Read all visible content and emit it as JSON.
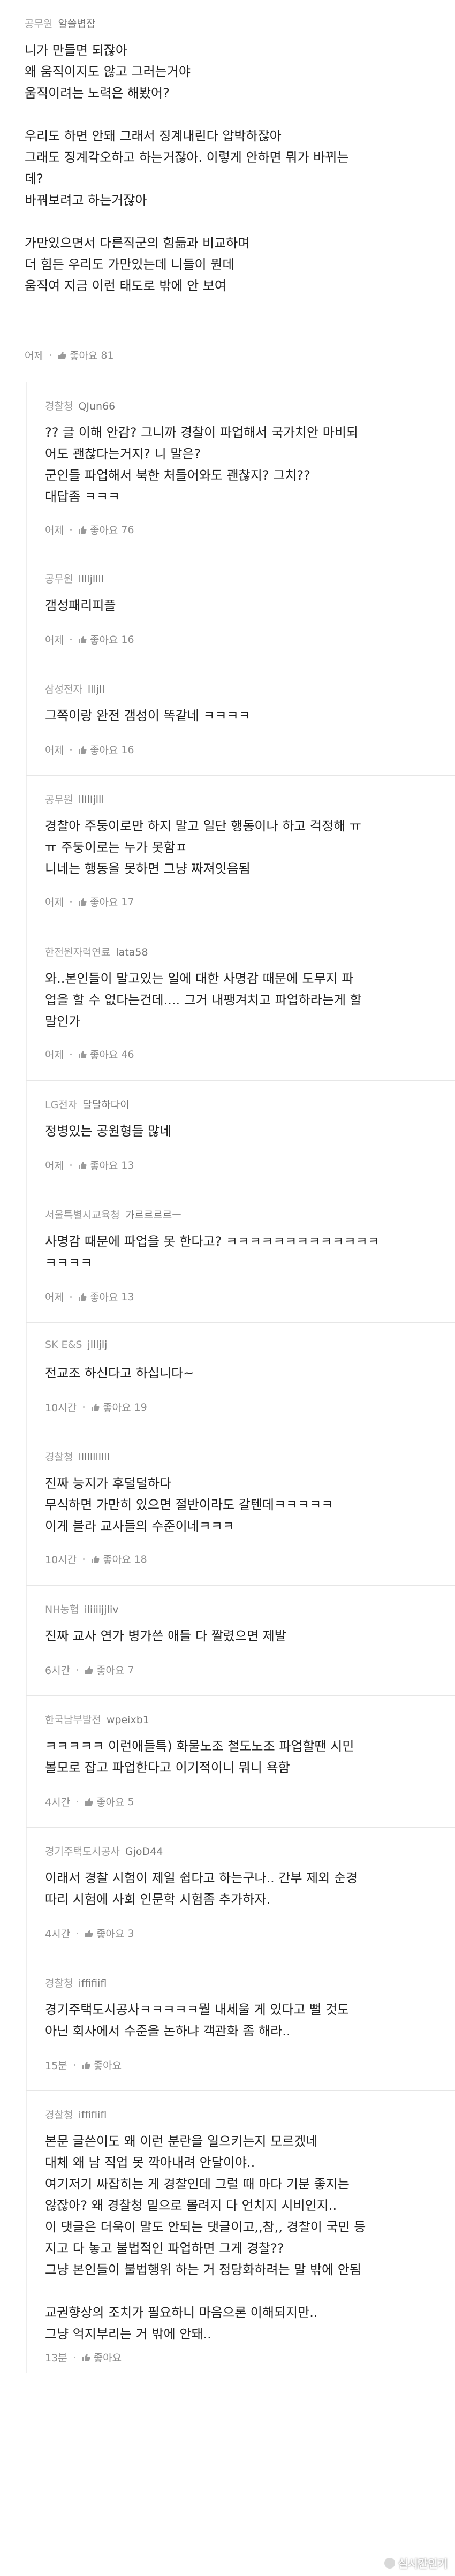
{
  "comments": [
    {
      "meta": "공무원",
      "nick": "알쓸볍잡",
      "lines": [
        "니가 만들면 되잖아",
        "왜 움직이지도 않고 그러는거야",
        "움직이려는 노력은 해봤어?",
        "",
        "우리도 하면 안돼 그래서 징계내린다 압박하잖아",
        "그래도 징계각오하고 하는거잖아. 이렇게 안하면 뭐가 바뀌는",
        "데?",
        "바꿔보려고 하는거잖아",
        "",
        "가만있으면서 다른직군의 힘듦과 비교하며",
        "더 힘든 우리도 가만있는데 니들이 뭔데",
        "움직여 지금 이런 태도로 밖에 안 보여"
      ],
      "time": "어제",
      "like_label": "좋아요",
      "likes": "81"
    },
    {
      "meta": "경찰청",
      "nick": "QJun66",
      "lines": [
        "?? 글 이해 안감? 그니까 경찰이 파업해서 국가치안 마비되",
        "어도 괜찮다는거지? 니 말은?",
        "군인들 파업해서 북한 처들어와도 괜찮지? 그치??",
        "대답좀 ㅋㅋㅋ"
      ],
      "time": "어제",
      "like_label": "좋아요",
      "likes": "76"
    },
    {
      "meta": "공무원",
      "nick": "lllljllll",
      "lines": [
        "갬성패리피플"
      ],
      "time": "어제",
      "like_label": "좋아요",
      "likes": "16"
    },
    {
      "meta": "삼성전자",
      "nick": "llljll",
      "lines": [
        "그쪽이랑 완전 갬성이 똑같네 ㅋㅋㅋㅋ"
      ],
      "time": "어제",
      "like_label": "좋아요",
      "likes": "16"
    },
    {
      "meta": "공무원",
      "nick": "llIlIjlll",
      "lines": [
        "경찰아 주둥이로만 하지 말고 일단 행동이나 하고 걱정해 ㅠ",
        "ㅠ 주둥이로는 누가 못함ㅍ",
        "니네는 행동을 못하면 그냥 짜져잇음됨"
      ],
      "time": "어제",
      "like_label": "좋아요",
      "likes": "17"
    },
    {
      "meta": "한전원자력연료",
      "nick": "lata58",
      "lines": [
        "와..본인들이 말고있는 일에 대한 사명감 때문에 도무지 파",
        "업을 할 수 없다는건데.... 그거 내팽겨치고 파업하라는게 할",
        "말인가"
      ],
      "time": "어제",
      "like_label": "좋아요",
      "likes": "46"
    },
    {
      "meta": "LG전자",
      "nick": "달달하다이",
      "lines": [
        "정병있는 공원형들 많네"
      ],
      "time": "어제",
      "like_label": "좋아요",
      "likes": "13"
    },
    {
      "meta": "서울특별시교육청",
      "nick": "가르르르르ㅡ",
      "lines": [
        "사명감 때문에 파업을 못 한다고? ㅋㅋㅋㅋㅋㅋㅋㅋㅋㅋㅋㅋㅋ",
        "ㅋㅋㅋㅋ"
      ],
      "time": "어제",
      "like_label": "좋아요",
      "likes": "13"
    },
    {
      "meta": "SK E&S",
      "nick": "jllljlj",
      "lines": [
        "전교조 하신다고 하십니다~"
      ],
      "time": "10시간",
      "like_label": "좋아요",
      "likes": "19"
    },
    {
      "meta": "경찰청",
      "nick": "lllIlllllll",
      "lines": [
        "진짜 능지가 후덜덜하다",
        "무식하면 가만히 있으면 절반이라도 갈텐데ㅋㅋㅋㅋㅋ",
        "이게 블라 교사들의 수준이네ㅋㅋㅋ"
      ],
      "time": "10시간",
      "like_label": "좋아요",
      "likes": "18"
    },
    {
      "meta": "NH농협",
      "nick": "iliiiijjliv",
      "lines": [
        "진짜 교사 연가 병가쓴 애들 다 짤렸으면 제발"
      ],
      "time": "6시간",
      "like_label": "좋아요",
      "likes": "7"
    },
    {
      "meta": "한국남부발전",
      "nick": "wpeixb1",
      "lines": [
        "ㅋㅋㅋㅋㅋ 이런애들특) 화물노조 철도노조 파업할땐 시민",
        "볼모로 잡고 파업한다고 이기적이니 뭐니 욕함"
      ],
      "time": "4시간",
      "like_label": "좋아요",
      "likes": "5"
    },
    {
      "meta": "경기주택도시공사",
      "nick": "GjoD44",
      "lines": [
        "이래서 경찰 시험이 제일 쉽다고 하는구나.. 간부 제외 순경",
        "따리 시험에 사회 인문학 시험좀 추가하자."
      ],
      "time": "4시간",
      "like_label": "좋아요",
      "likes": "3"
    },
    {
      "meta": "경찰청",
      "nick": "iffifiifl",
      "lines": [
        "경기주택도시공사ㅋㅋㅋㅋㅋ뭘 내세울 게 있다고 뻘 것도",
        "아닌 회사에서 수준을 논하냐 객관화 좀 해라.."
      ],
      "time": "15분",
      "like_label": "좋아요",
      "likes": ""
    },
    {
      "meta": "경찰청",
      "nick": "iffifiifl",
      "lines": [
        "본문 글쓴이도 왜 이런 분란을 일으키는지 모르겠네",
        "대체 왜 남 직업 못 깍아내려 안달이야..",
        "여기저기 싸잡히는 게 경찰인데 그럴 때 마다 기분 좋지는",
        "않잖아? 왜 경찰청 밑으로 몰려지 다 언치지 시비인지..",
        "이 댓글은 더욱이 말도 안되는 댓글이고,,참,, 경찰이 국민 등",
        "지고 다 놓고 불법적인 파업하면 그게 경찰??",
        "그냥 본인들이 불법행위 하는 거 정당화하려는 말 밖에 안됨",
        "",
        "교권향상의 조치가 필요하니 마음으론 이해되지만..",
        "그냥 억지부리는 거 밖에 안돼.."
      ],
      "time": "13분",
      "like_label": "좋아요",
      "likes": ""
    }
  ],
  "watermark": "실시간인기"
}
